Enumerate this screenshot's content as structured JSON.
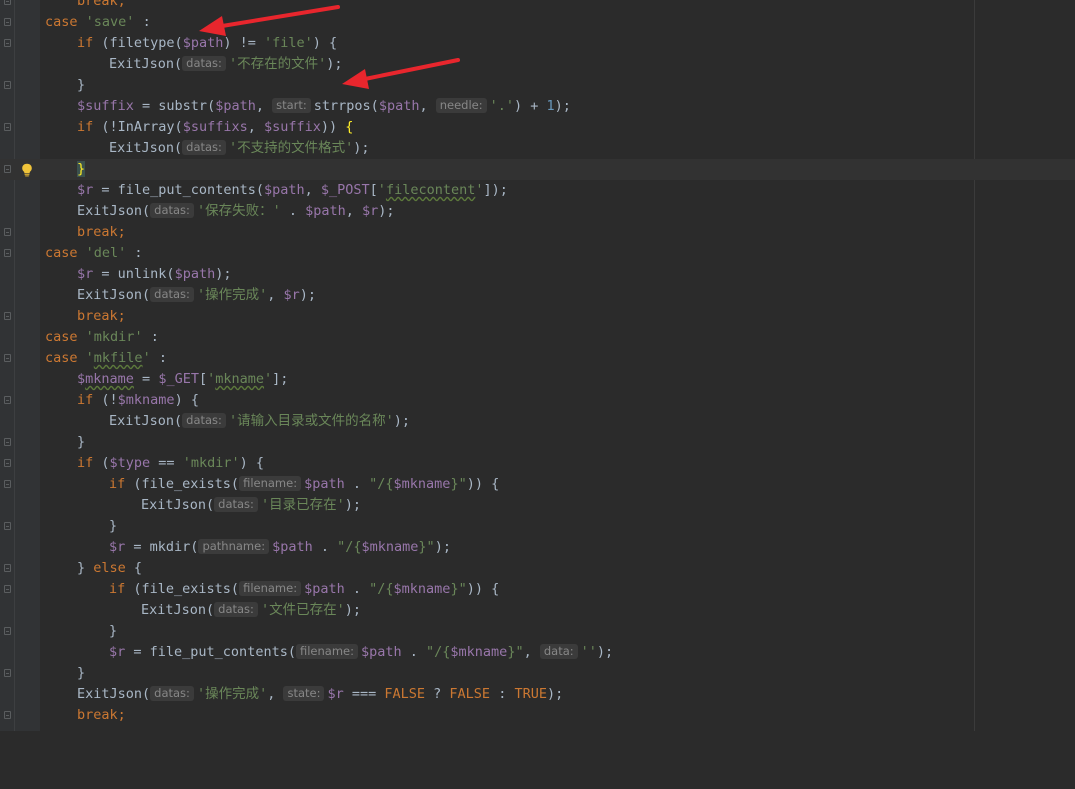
{
  "editor": {
    "theme_colors": {
      "background": "#2b2b2b",
      "gutter": "#313335",
      "keyword": "#cc7832",
      "variable": "#9876aa",
      "string": "#6a8759",
      "number": "#6897bb",
      "default": "#a9b7c6",
      "hint": "#878787",
      "annotation_arrow": "#e8262d"
    },
    "lines": [
      {
        "text": "break;"
      },
      {
        "text": "case 'save' :"
      },
      {
        "text": "if (filetype($path) != 'file') {"
      },
      {
        "text": "ExitJson(datas:'不存在的文件');"
      },
      {
        "text": "}"
      },
      {
        "text": "$suffix = substr($path, start:strrpos($path, needle:'.') + 1);"
      },
      {
        "text": "if (!InArray($suffixs, $suffix)) {"
      },
      {
        "text": "ExitJson(datas:'不支持的文件格式');"
      },
      {
        "text": "}"
      },
      {
        "text": "$r = file_put_contents($path, $_POST['filecontent']);"
      },
      {
        "text": "ExitJson(datas:'保存失败：' . $path, $r);"
      },
      {
        "text": "break;"
      },
      {
        "text": "case 'del' :"
      },
      {
        "text": "$r = unlink($path);"
      },
      {
        "text": "ExitJson(datas:'操作完成', $r);"
      },
      {
        "text": "break;"
      },
      {
        "text": "case 'mkdir' :"
      },
      {
        "text": "case 'mkfile' :"
      },
      {
        "text": "$mkname = $_GET['mkname'];"
      },
      {
        "text": "if (!$mkname) {"
      },
      {
        "text": "ExitJson(datas:'请输入目录或文件的名称');"
      },
      {
        "text": "}"
      },
      {
        "text": "if ($type == 'mkdir') {"
      },
      {
        "text": "if (file_exists(filename:$path . \"/{$mkname}\")) {"
      },
      {
        "text": "ExitJson(datas:'目录已存在');"
      },
      {
        "text": "}"
      },
      {
        "text": "$r = mkdir(pathname:$path . \"/{$mkname}\");"
      },
      {
        "text": "} else {"
      },
      {
        "text": "if (file_exists(filename:$path . \"/{$mkname}\")) {"
      },
      {
        "text": "ExitJson(datas:'文件已存在');"
      },
      {
        "text": "}"
      },
      {
        "text": "$r = file_put_contents(filename:$path . \"/{$mkname}\", data:'');"
      },
      {
        "text": "}"
      },
      {
        "text": "ExitJson(datas:'操作完成', state:$r === FALSE ? FALSE : TRUE);"
      },
      {
        "text": "break;"
      }
    ],
    "tokens": {
      "break": "break",
      "case": "case",
      "if": "if",
      "else": "else",
      "semicolon": ";",
      "colon": " :",
      "s_save": "'save'",
      "s_file": "'file'",
      "s_del": "'del'",
      "s_mkdir_q": "'",
      "s_mkdir": "mkdir",
      "s_mkfile": "mkfile",
      "s_dot": "'.'",
      "s_filecontent_q": "'",
      "s_filecontent": "filecontent",
      "s_mkname": "mkname",
      "s_msg1": "'不存在的文件'",
      "s_msg2": "'不支持的文件格式'",
      "s_msg3": "'保存失败：'",
      "s_msg4": "'操作完成'",
      "s_msg5": "'请输入目录或文件的名称'",
      "s_msg6": "'目录已存在'",
      "s_msg7": "'文件已存在'",
      "s_empty": "''",
      "s_path_open": "\"/{",
      "s_path_close": "}\"",
      "v_path": "$path",
      "v_suffix": "$suffix",
      "v_suffixs": "$suffixs",
      "v_r": "$r",
      "v_post": "$_POST",
      "v_get": "$_GET",
      "v_mkname_pre": "$",
      "v_mkname": "mkname",
      "v_type": "$type",
      "f_filetype": "filetype(",
      "f_exitjson": "ExitJson(",
      "f_substr": "substr(",
      "f_strrpos": "strrpos(",
      "f_inarray": "InArray(",
      "f_fpc": "file_put_contents(",
      "f_unlink": "unlink(",
      "f_fexists": "file_exists(",
      "f_mkdir": "mkdir(",
      "c_false": "FALSE",
      "c_true": "TRUE",
      "n_one": "1",
      "h_datas": "datas:",
      "h_start": "start:",
      "h_needle": "needle:",
      "h_filename": "filename:",
      "h_pathname": "pathname:",
      "h_data": "data:",
      "h_state": "state:"
    }
  }
}
